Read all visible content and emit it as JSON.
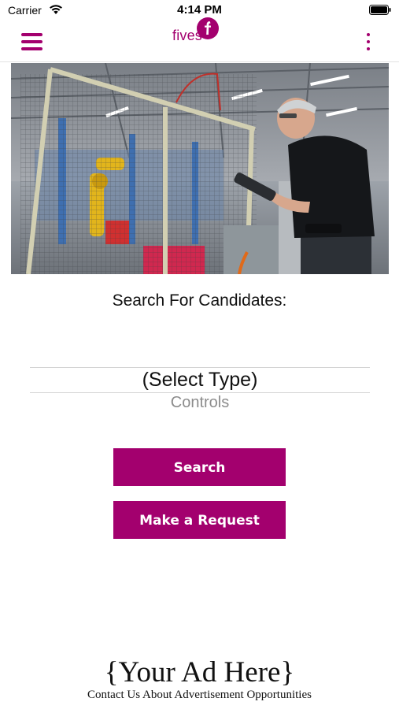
{
  "status_bar": {
    "carrier": "Carrier",
    "time": "4:14 PM",
    "wifi_icon": "wifi-icon",
    "battery_icon": "battery-icon"
  },
  "nav": {
    "menu_icon": "hamburger-menu-icon",
    "logo_text": "fives",
    "logo_badge_letter": "f",
    "more_icon": "more-vertical-icon"
  },
  "hero": {
    "icon": "factory-photo"
  },
  "search": {
    "label": "Search For Candidates:",
    "picker_selected": "(Select Type)",
    "picker_next": "Controls"
  },
  "buttons": {
    "search": "Search",
    "request": "Make a Request"
  },
  "ad": {
    "title": "{Your Ad Here}",
    "subtitle": "Contact Us About Advertisement Opportunities"
  },
  "colors": {
    "brand": "#a3006e",
    "text": "#111111",
    "muted": "#8c8c8c"
  }
}
